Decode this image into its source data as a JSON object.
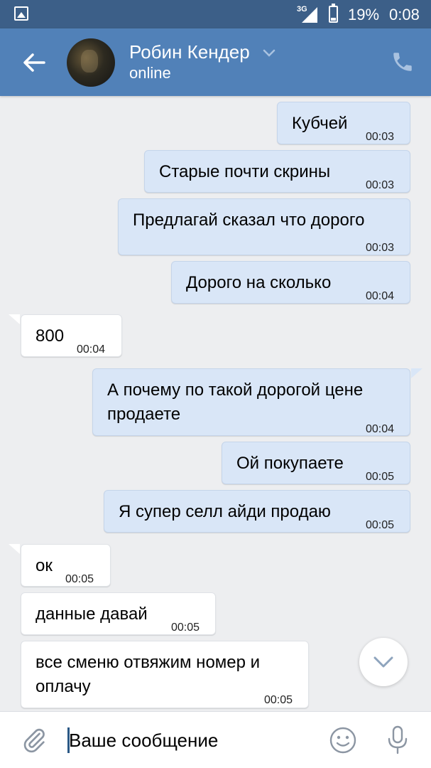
{
  "statusbar": {
    "network": "3G",
    "battery": "19%",
    "time": "0:08",
    "icons": [
      "image-notification-icon",
      "signal-icon",
      "battery-icon"
    ]
  },
  "header": {
    "name": "Робин Кендер",
    "status": "online",
    "icons": [
      "back-arrow-icon",
      "chevron-down-icon",
      "phone-icon"
    ]
  },
  "messages": [
    {
      "dir": "out",
      "text": "Кубчей",
      "time": "00:03"
    },
    {
      "dir": "out",
      "text": "Старые почти скрины",
      "time": "00:03"
    },
    {
      "dir": "out",
      "text": "Предлагай сказал что дорого",
      "time": "00:03"
    },
    {
      "dir": "out",
      "text": "Дорого на сколько",
      "time": "00:04"
    },
    {
      "dir": "in",
      "text": "800",
      "time": "00:04"
    },
    {
      "dir": "out",
      "text": "А почему по такой дорогой цене продаете",
      "time": "00:04"
    },
    {
      "dir": "out",
      "text": "Ой покупаете",
      "time": "00:05"
    },
    {
      "dir": "out",
      "text": "Я супер селл айди продаю",
      "time": "00:05"
    },
    {
      "dir": "in",
      "text": "ок",
      "time": "00:05"
    },
    {
      "dir": "in",
      "text": "данные давай",
      "time": "00:05"
    },
    {
      "dir": "in",
      "text": "все сменю отвяжим номер и оплачу",
      "time": "00:05"
    }
  ],
  "input": {
    "placeholder": "Ваше сообщение",
    "icons": [
      "paperclip-icon",
      "smile-icon",
      "microphone-icon",
      "scroll-down-icon"
    ]
  },
  "colors": {
    "statusbar": "#3c5f88",
    "header": "#5181b8",
    "background": "#edeef0",
    "outgoing_bubble": "#d9e6f7",
    "incoming_bubble": "#ffffff"
  }
}
